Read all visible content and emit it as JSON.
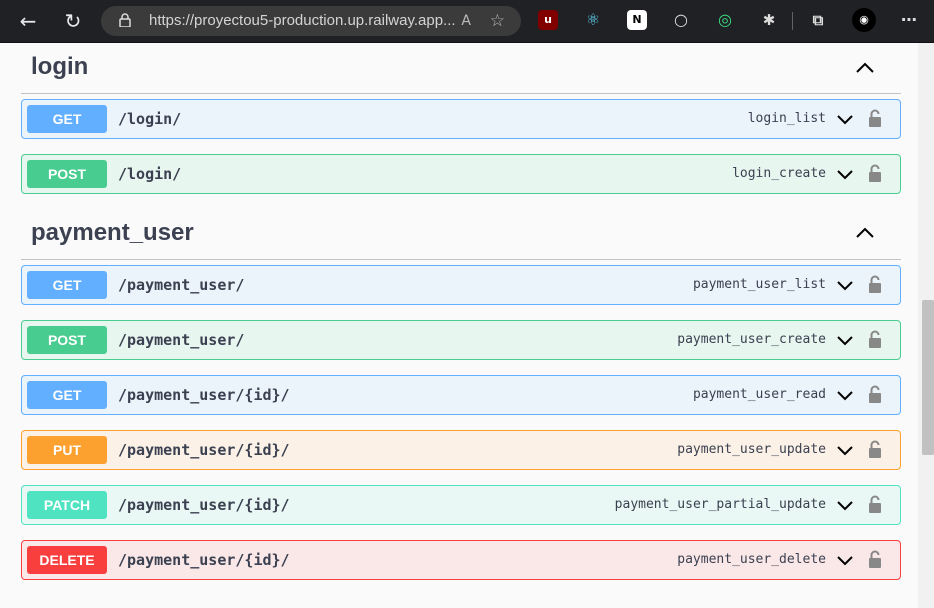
{
  "browser": {
    "url": "https://proyectou5-production.up.railway.app..."
  },
  "sections": [
    {
      "title": "login",
      "ops": [
        {
          "method": "GET",
          "kind": "get",
          "path": "/login/",
          "op_id": "login_list"
        },
        {
          "method": "POST",
          "kind": "post",
          "path": "/login/",
          "op_id": "login_create"
        }
      ]
    },
    {
      "title": "payment_user",
      "ops": [
        {
          "method": "GET",
          "kind": "get",
          "path": "/payment_user/",
          "op_id": "payment_user_list"
        },
        {
          "method": "POST",
          "kind": "post",
          "path": "/payment_user/",
          "op_id": "payment_user_create"
        },
        {
          "method": "GET",
          "kind": "get",
          "path": "/payment_user/{id}/",
          "op_id": "payment_user_read"
        },
        {
          "method": "PUT",
          "kind": "put",
          "path": "/payment_user/{id}/",
          "op_id": "payment_user_update"
        },
        {
          "method": "PATCH",
          "kind": "patch",
          "path": "/payment_user/{id}/",
          "op_id": "payment_user_partial_update"
        },
        {
          "method": "DELETE",
          "kind": "delete",
          "path": "/payment_user/{id}/",
          "op_id": "payment_user_delete"
        }
      ]
    }
  ],
  "colors": {
    "get": "#61affe",
    "post": "#49cc90",
    "put": "#fca130",
    "patch": "#50e3c2",
    "delete": "#f93e3e"
  },
  "icons": {
    "collapse": "chevron-up-icon",
    "expand": "chevron-down-icon",
    "auth": "lock-icon"
  }
}
